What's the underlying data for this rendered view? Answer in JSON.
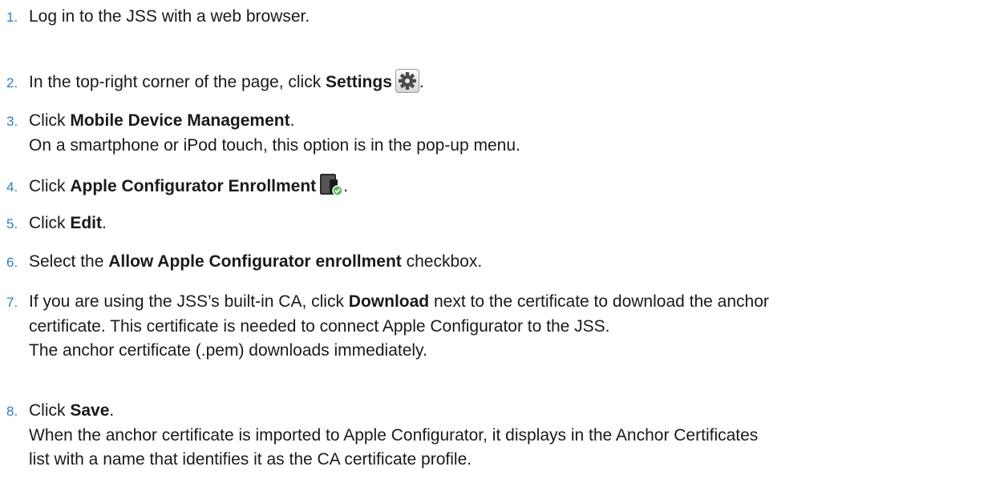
{
  "steps": [
    {
      "number": "1.",
      "text": "Log in to the JSS with a web browser."
    },
    {
      "number": "2.",
      "before": "In the top-right corner of the page, click ",
      "bold": "Settings",
      "icon": "settings-gear-icon",
      "after": "."
    },
    {
      "number": "3.",
      "before": "Click ",
      "bold": "Mobile Device Management",
      "after": ".",
      "note": "On a smartphone or iPod touch, this option is in the pop-up menu."
    },
    {
      "number": "4.",
      "before": "Click ",
      "bold": "Apple Configurator Enrollment",
      "icon": "device-enrollment-icon",
      "after": "."
    },
    {
      "number": "5.",
      "before": "Click ",
      "bold": "Edit",
      "after": "."
    },
    {
      "number": "6.",
      "before": "Select the ",
      "bold": "Allow Apple Configurator enrollment",
      "after": " checkbox."
    },
    {
      "number": "7.",
      "before": "If you are using the JSS’s built-in CA, click ",
      "bold": "Download",
      "after": " next to the certificate to download the anchor",
      "line2": "certificate. This certificate is needed to connect Apple Configurator to the JSS.",
      "note": "The anchor certificate (.pem) downloads immediately."
    },
    {
      "number": "8.",
      "before": "Click ",
      "bold": "Save",
      "after": ".",
      "note": "When the anchor certificate is imported to Apple Configurator, it displays in the Anchor Certificates",
      "note2": "list with a name that identifies it as the CA certificate profile."
    }
  ]
}
